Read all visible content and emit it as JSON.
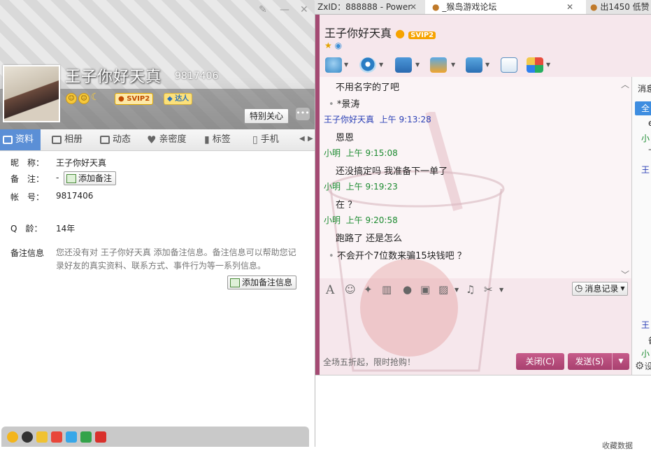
{
  "profile": {
    "nickname": "王子你好天真",
    "qq_number": "9817406",
    "vip_badge": "SVIP2",
    "talent_badge": "达人",
    "follow_button": "特别关心",
    "tabs": [
      {
        "label": "资料",
        "icon": "profile-card-icon"
      },
      {
        "label": "相册",
        "icon": "album-icon"
      },
      {
        "label": "动态",
        "icon": "feed-icon"
      },
      {
        "label": "亲密度",
        "icon": "heart-icon"
      },
      {
        "label": "标签",
        "icon": "tag-icon"
      },
      {
        "label": "手机",
        "icon": "phone-icon"
      }
    ],
    "fields": {
      "nickname_label": "昵　称：",
      "nickname_value": "王子你好天真",
      "remark_label": "备　注：",
      "remark_value": "-",
      "add_remark_button": "添加备注",
      "account_label": "帐　号：",
      "account_value": "9817406",
      "qage_label": "Q　龄：",
      "qage_value": "14年",
      "remark_info_label": "备注信息",
      "remark_info_text": "您还没有对 王子你好天真 添加备注信息。备注信息可以帮助您记录好友的真实资料、联系方式、事件行为等一系列信息。",
      "add_remark_info_button": "添加备注信息"
    }
  },
  "browser_tabs": [
    {
      "title": "ZxID：888888 - Power"
    },
    {
      "title": "_猴岛游戏论坛"
    },
    {
      "title": "出1450 低赞"
    }
  ],
  "chat": {
    "title": "王子你好天真",
    "vip_badge": "SVIP2",
    "messages": [
      {
        "type": "text",
        "text": "不用名字的了吧"
      },
      {
        "type": "bullet",
        "text": "*景涛"
      },
      {
        "type": "header",
        "sender": "王子你好天真",
        "time": "上午 9:13:28",
        "color": "#2a3fb5"
      },
      {
        "type": "text",
        "text": "恩恩"
      },
      {
        "type": "header",
        "sender": "小明",
        "time": "上午 9:15:08",
        "color": "#1b8a2f"
      },
      {
        "type": "text",
        "text": "还没搞定吗  我准备下一单了"
      },
      {
        "type": "header",
        "sender": "小明",
        "time": "上午 9:19:23",
        "color": "#1b8a2f"
      },
      {
        "type": "text",
        "text": "在 ？"
      },
      {
        "type": "header",
        "sender": "小明",
        "time": "上午 9:20:58",
        "color": "#1b8a2f"
      },
      {
        "type": "text",
        "text": "跑路了  还是怎么"
      },
      {
        "type": "bullet",
        "text": "不会开个7位数来骗15块钱吧 ？"
      }
    ],
    "history_button": "消息记录",
    "promo": "全场五折起，限时抢购！",
    "close_button": "关闭(C)",
    "send_button": "发送(S)",
    "side_panel": {
      "header": "消息",
      "tab": "全",
      "item1": "e",
      "item2": "小",
      "item3": "下",
      "item4": "王",
      "item5": "王",
      "item6": "备",
      "item7": "小",
      "settings": "设"
    }
  },
  "bottom_strip_text": "收藏数据"
}
